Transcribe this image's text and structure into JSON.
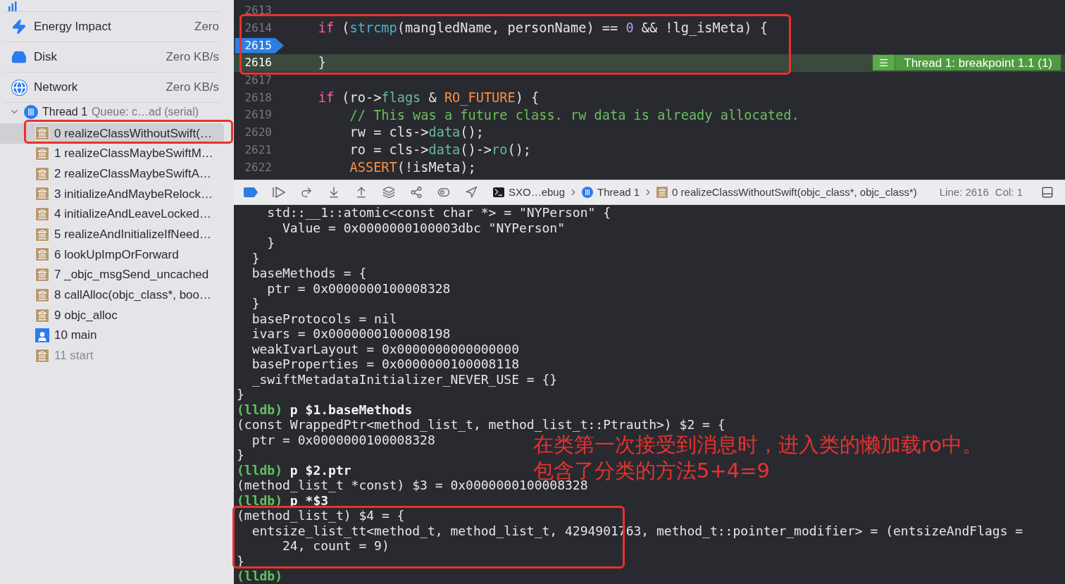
{
  "sidebar": {
    "gauges": [
      {
        "label": "Energy Impact",
        "value": "Zero",
        "kind": "energy"
      },
      {
        "label": "Disk",
        "value": "Zero KB/s",
        "kind": "disk"
      },
      {
        "label": "Network",
        "value": "Zero KB/s",
        "kind": "network"
      }
    ],
    "thread": {
      "title": "Thread 1",
      "detail": "Queue: c…ad (serial)",
      "expanded": true
    },
    "frames": [
      {
        "label": "0 realizeClassWithoutSwift(…",
        "kind": "library",
        "selected": true,
        "dimmed": false
      },
      {
        "label": "1 realizeClassMaybeSwiftM…",
        "kind": "library",
        "selected": false,
        "dimmed": false
      },
      {
        "label": "2 realizeClassMaybeSwiftA…",
        "kind": "library",
        "selected": false,
        "dimmed": false
      },
      {
        "label": "3 initializeAndMaybeRelock…",
        "kind": "library",
        "selected": false,
        "dimmed": false
      },
      {
        "label": "4 initializeAndLeaveLocked…",
        "kind": "library",
        "selected": false,
        "dimmed": false
      },
      {
        "label": "5 realizeAndInitializeIfNeed…",
        "kind": "library",
        "selected": false,
        "dimmed": false
      },
      {
        "label": "6 lookUpImpOrForward",
        "kind": "library",
        "selected": false,
        "dimmed": false
      },
      {
        "label": "7 _objc_msgSend_uncached",
        "kind": "library",
        "selected": false,
        "dimmed": false
      },
      {
        "label": "8 callAlloc(objc_class*, boo…",
        "kind": "library",
        "selected": false,
        "dimmed": false
      },
      {
        "label": "9 objc_alloc",
        "kind": "library",
        "selected": false,
        "dimmed": false
      },
      {
        "label": "10 main",
        "kind": "user",
        "selected": false,
        "dimmed": false
      },
      {
        "label": "11 start",
        "kind": "library",
        "selected": false,
        "dimmed": true
      }
    ]
  },
  "editor": {
    "lines": [
      {
        "number": "2613",
        "breakpoint": false,
        "current": false
      },
      {
        "number": "2614",
        "breakpoint": false,
        "current": false,
        "tokens": [
          {
            "text": "    if",
            "kind": "keyword"
          },
          {
            "text": " (",
            "kind": "plain"
          },
          {
            "text": "strcmp",
            "kind": "func"
          },
          {
            "text": "(mangledName, personName) == ",
            "kind": "plain"
          },
          {
            "text": "0",
            "kind": "number"
          },
          {
            "text": " && !lg_isMeta) {",
            "kind": "plain"
          }
        ]
      },
      {
        "number": "2615",
        "breakpoint": true,
        "current": false
      },
      {
        "number": "2616",
        "breakpoint": false,
        "current": true,
        "badge": "Thread 1: breakpoint 1.1 (1)",
        "tokens": [
          {
            "text": "    }",
            "kind": "plain"
          }
        ]
      },
      {
        "number": "2617",
        "breakpoint": false,
        "current": false
      },
      {
        "number": "2618",
        "breakpoint": false,
        "current": false,
        "tokens": [
          {
            "text": "    if",
            "kind": "keyword"
          },
          {
            "text": " (ro->",
            "kind": "plain"
          },
          {
            "text": "flags",
            "kind": "member"
          },
          {
            "text": " & ",
            "kind": "plain"
          },
          {
            "text": "RO_FUTURE",
            "kind": "macro"
          },
          {
            "text": ") {",
            "kind": "plain"
          }
        ]
      },
      {
        "number": "2619",
        "breakpoint": false,
        "current": false,
        "tokens": [
          {
            "text": "        // This was a future class. rw data is already allocated.",
            "kind": "comment"
          }
        ]
      },
      {
        "number": "2620",
        "breakpoint": false,
        "current": false,
        "tokens": [
          {
            "text": "        rw = cls->",
            "kind": "plain"
          },
          {
            "text": "data",
            "kind": "member"
          },
          {
            "text": "();",
            "kind": "plain"
          }
        ]
      },
      {
        "number": "2621",
        "breakpoint": false,
        "current": false,
        "tokens": [
          {
            "text": "        ro = cls->",
            "kind": "plain"
          },
          {
            "text": "data",
            "kind": "member"
          },
          {
            "text": "()->",
            "kind": "plain"
          },
          {
            "text": "ro",
            "kind": "member"
          },
          {
            "text": "();",
            "kind": "plain"
          }
        ]
      },
      {
        "number": "2622",
        "breakpoint": false,
        "current": false,
        "tokens": [
          {
            "text": "        ASSERT",
            "kind": "macro"
          },
          {
            "text": "(!isMeta);",
            "kind": "plain"
          }
        ]
      }
    ]
  },
  "debug_bar": {
    "target": "SXO…ebug",
    "thread": "Thread 1",
    "frame": "0 realizeClassWithoutSwift(objc_class*, objc_class*)",
    "line": "Line: 2616",
    "column": "Col: 1"
  },
  "console": {
    "lines": [
      [
        {
          "text": "    std::__1::atomic<const char *> = \"NYPerson\" {",
          "kind": "output"
        }
      ],
      [
        {
          "text": "      Value = 0x0000000100003dbc \"NYPerson\"",
          "kind": "output"
        }
      ],
      [
        {
          "text": "    }",
          "kind": "output"
        }
      ],
      [
        {
          "text": "  }",
          "kind": "output"
        }
      ],
      [
        {
          "text": "  baseMethods = {",
          "kind": "output"
        }
      ],
      [
        {
          "text": "    ptr = 0x0000000100008328",
          "kind": "output"
        }
      ],
      [
        {
          "text": "  }",
          "kind": "output"
        }
      ],
      [
        {
          "text": "  baseProtocols = nil",
          "kind": "output"
        }
      ],
      [
        {
          "text": "  ivars = 0x0000000100008198",
          "kind": "output"
        }
      ],
      [
        {
          "text": "  weakIvarLayout = 0x0000000000000000",
          "kind": "output"
        }
      ],
      [
        {
          "text": "  baseProperties = 0x0000000100008118",
          "kind": "output"
        }
      ],
      [
        {
          "text": "  _swiftMetadataInitializer_NEVER_USE = {}",
          "kind": "output"
        }
      ],
      [
        {
          "text": "}",
          "kind": "output"
        }
      ],
      [
        {
          "text": "(lldb)",
          "kind": "prompt"
        },
        {
          "text": " p $1.baseMethods",
          "kind": "command"
        }
      ],
      [
        {
          "text": "(const WrappedPtr<method_list_t, method_list_t::Ptrauth>) $2 = {",
          "kind": "output"
        }
      ],
      [
        {
          "text": "  ptr = 0x0000000100008328",
          "kind": "output"
        }
      ],
      [
        {
          "text": "}",
          "kind": "output"
        }
      ],
      [
        {
          "text": "(lldb)",
          "kind": "prompt"
        },
        {
          "text": " p $2.ptr",
          "kind": "command"
        }
      ],
      [
        {
          "text": "(method_list_t *const) $3 = 0x0000000100008328",
          "kind": "output"
        }
      ],
      [
        {
          "text": "(lldb)",
          "kind": "prompt"
        },
        {
          "text": " p *$3",
          "kind": "command"
        }
      ],
      [
        {
          "text": "(method_list_t) $4 = {",
          "kind": "output"
        }
      ],
      [
        {
          "text": "  entsize_list_tt<method_t, method_list_t, 4294901763, method_t::pointer_modifier> = (entsizeAndFlags =",
          "kind": "output"
        }
      ],
      [
        {
          "text": "      24, count = 9)",
          "kind": "output"
        }
      ],
      [
        {
          "text": "}",
          "kind": "output"
        }
      ],
      [
        {
          "text": "(lldb)",
          "kind": "prompt"
        }
      ]
    ]
  },
  "annotation": {
    "lines": [
      "在类第一次接受到消息时，进入类的懒加载ro中。",
      "包含了分类的方法5+4=9"
    ]
  }
}
